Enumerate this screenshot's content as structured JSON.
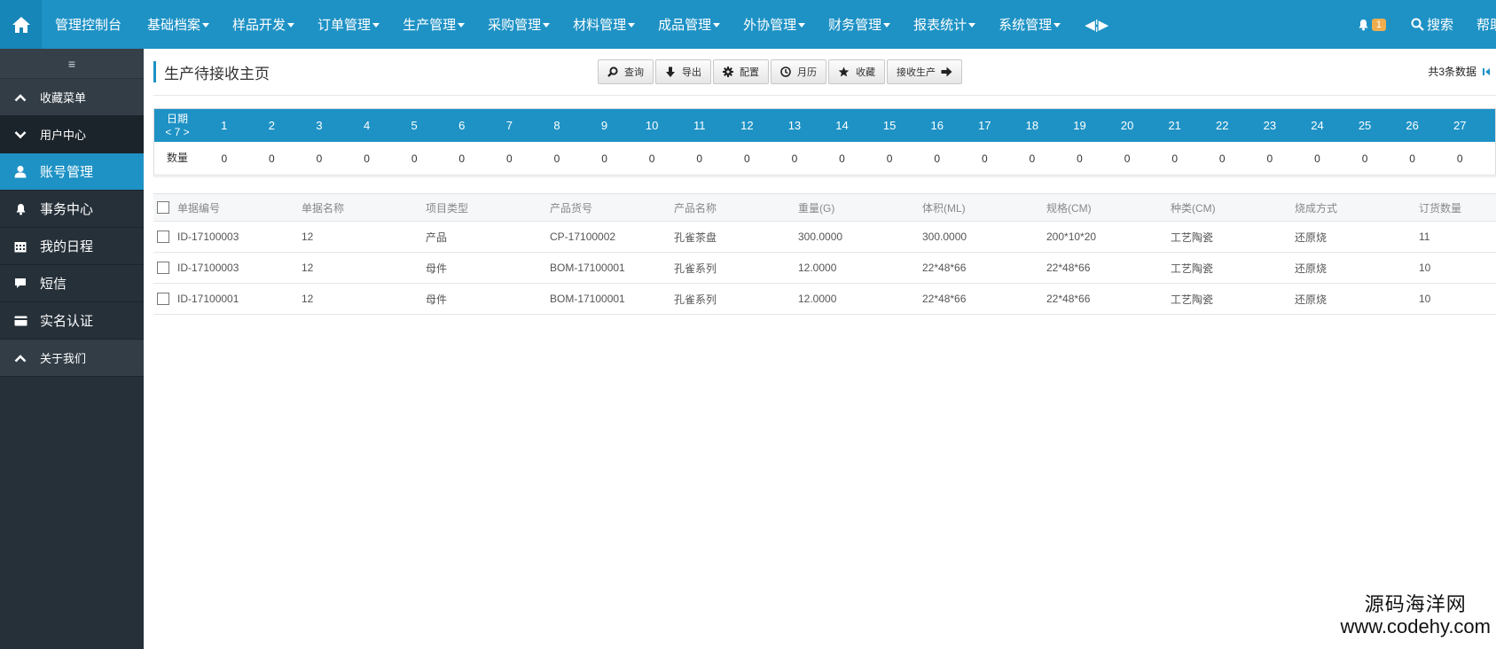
{
  "topbar": {
    "menu": [
      {
        "label": "管理控制台",
        "dropdown": false,
        "name": "nav-dashboard"
      },
      {
        "label": "基础档案",
        "dropdown": true,
        "name": "nav-basic-archive"
      },
      {
        "label": "样品开发",
        "dropdown": true,
        "name": "nav-sample-dev"
      },
      {
        "label": "订单管理",
        "dropdown": true,
        "name": "nav-order-mgmt"
      },
      {
        "label": "生产管理",
        "dropdown": true,
        "name": "nav-production-mgmt"
      },
      {
        "label": "采购管理",
        "dropdown": true,
        "name": "nav-purchase-mgmt"
      },
      {
        "label": "材料管理",
        "dropdown": true,
        "name": "nav-material-mgmt"
      },
      {
        "label": "成品管理",
        "dropdown": true,
        "name": "nav-product-mgmt"
      },
      {
        "label": "外协管理",
        "dropdown": true,
        "name": "nav-outsource-mgmt"
      },
      {
        "label": "财务管理",
        "dropdown": true,
        "name": "nav-finance-mgmt"
      },
      {
        "label": "报表统计",
        "dropdown": true,
        "name": "nav-report-stats"
      },
      {
        "label": "系统管理",
        "dropdown": true,
        "name": "nav-system-mgmt"
      }
    ],
    "toggle_label": "◀¦▶",
    "notification_count": "1",
    "search_label": "搜索",
    "help_label": "帮助"
  },
  "sidebar": {
    "toggle_label": "≡",
    "items": [
      {
        "label": "收藏菜单",
        "icon": "chevron-up-icon"
      },
      {
        "label": "用户中心",
        "icon": "chevron-down-icon"
      },
      {
        "label": "账号管理",
        "icon": "user-icon"
      },
      {
        "label": "事务中心",
        "icon": "bell-icon"
      },
      {
        "label": "我的日程",
        "icon": "calendar-icon"
      },
      {
        "label": "短信",
        "icon": "comment-icon"
      },
      {
        "label": "实名认证",
        "icon": "card-icon"
      },
      {
        "label": "关于我们",
        "icon": "chevron-up-icon"
      }
    ]
  },
  "page": {
    "title": "生产待接收主页",
    "total_text": "共3条数据"
  },
  "toolbar": {
    "query": "查询",
    "export": "导出",
    "config": "配置",
    "calendar": "月历",
    "favorite": "收藏",
    "receive": "接收生产"
  },
  "calendar": {
    "date_label": "日期",
    "month_nav": "< 7 >",
    "qty_label": "数量",
    "days": [
      "1",
      "2",
      "3",
      "4",
      "5",
      "6",
      "7",
      "8",
      "9",
      "10",
      "11",
      "12",
      "13",
      "14",
      "15",
      "16",
      "17",
      "18",
      "19",
      "20",
      "21",
      "22",
      "23",
      "24",
      "25",
      "26",
      "27"
    ],
    "counts": [
      "0",
      "0",
      "0",
      "0",
      "0",
      "0",
      "0",
      "0",
      "0",
      "0",
      "0",
      "0",
      "0",
      "0",
      "0",
      "0",
      "0",
      "0",
      "0",
      "0",
      "0",
      "0",
      "0",
      "0",
      "0",
      "0",
      "0"
    ]
  },
  "table": {
    "columns": [
      "单据编号",
      "单据名称",
      "项目类型",
      "产品货号",
      "产品名称",
      "重量(G)",
      "体积(ML)",
      "规格(CM)",
      "种类(CM)",
      "烧成方式",
      "订货数量"
    ],
    "rows": [
      [
        "ID-17100003",
        "12",
        "产品",
        "CP-17100002",
        "孔雀茶盘",
        "300.0000",
        "300.0000",
        "200*10*20",
        "工艺陶瓷",
        "还原烧",
        "11"
      ],
      [
        "ID-17100003",
        "12",
        "母件",
        "BOM-17100001",
        "孔雀系列",
        "12.0000",
        "22*48*66",
        "22*48*66",
        "工艺陶瓷",
        "还原烧",
        "10"
      ],
      [
        "ID-17100001",
        "12",
        "母件",
        "BOM-17100001",
        "孔雀系列",
        "12.0000",
        "22*48*66",
        "22*48*66",
        "工艺陶瓷",
        "还原烧",
        "10"
      ]
    ]
  },
  "watermark": {
    "line1": "源码海洋网",
    "line2": "www.codehy.com"
  }
}
